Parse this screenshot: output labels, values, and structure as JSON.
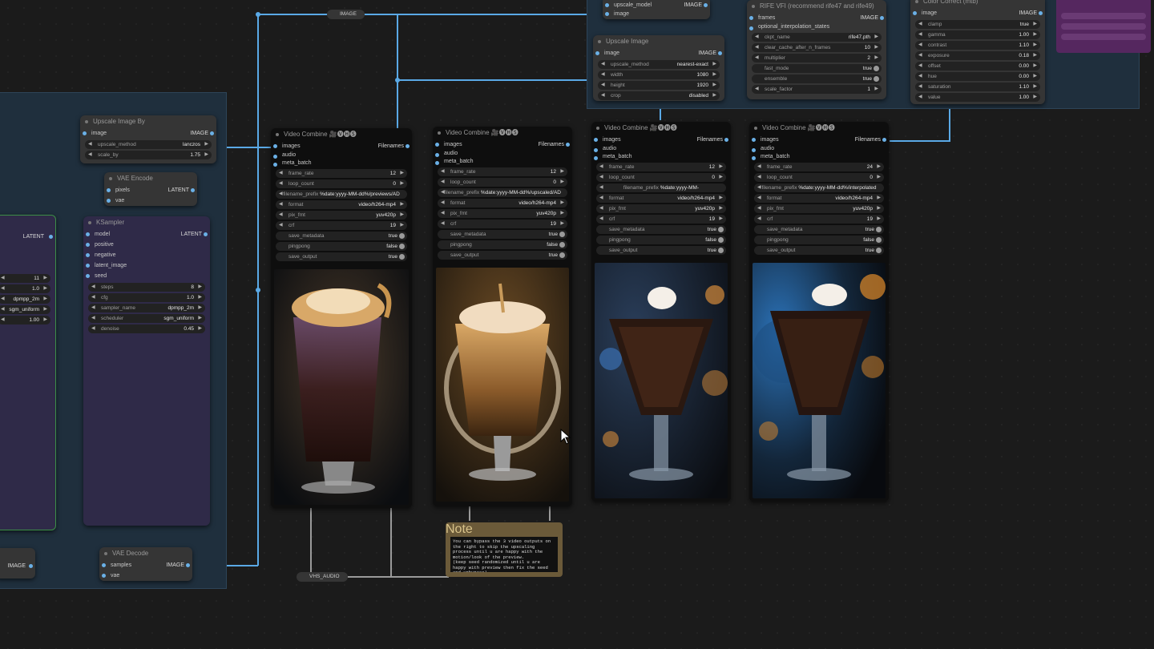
{
  "canvas": {
    "background": "#1b1b1b",
    "wire_blue": "#5aa9e6",
    "wire_pink": "#e6738a",
    "wire_yellow": "#e6c04a",
    "wire_gray": "#a0a0a0"
  },
  "nodes": {
    "upscale_image_by": {
      "title": "Upscale Image By",
      "input": "image",
      "output": "IMAGE",
      "widgets": [
        {
          "label": "upscale_method",
          "value": "lanczos"
        },
        {
          "label": "scale_by",
          "value": "1.75"
        }
      ]
    },
    "vae_encode": {
      "title": "VAE Encode",
      "inputs": [
        "pixels",
        "vae"
      ],
      "output": "LATENT"
    },
    "ksampler": {
      "title": "KSampler",
      "inputs": [
        "model",
        "positive",
        "negative",
        "latent_image"
      ],
      "seed_label": "seed",
      "output": "LATENT",
      "widgets": [
        {
          "label": "steps",
          "value": "8"
        },
        {
          "label": "cfg",
          "value": "1.0"
        },
        {
          "label": "sampler_name",
          "value": "dpmpp_2m"
        },
        {
          "label": "scheduler",
          "value": "sgm_uniform"
        },
        {
          "label": "denoise",
          "value": "0.45"
        }
      ]
    },
    "left_ksampler": {
      "output": "LATENT",
      "values": [
        "11",
        "1.0",
        "dpmpp_2m",
        "sgm_uniform",
        "1.00"
      ]
    },
    "vae_decode": {
      "title": "VAE Decode",
      "inputs": [
        "samples",
        "vae"
      ],
      "output": "IMAGE"
    },
    "left_image_output": "IMAGE",
    "upscale_model_loader": {
      "inputs": [
        "upscale_model",
        "image"
      ],
      "output": "IMAGE"
    },
    "reroute_image": "IMAGE",
    "upscale_image": {
      "title": "Upscale Image",
      "input": "image",
      "output": "IMAGE",
      "widgets": [
        {
          "label": "upscale_method",
          "value": "nearest-exact"
        },
        {
          "label": "width",
          "value": "1080"
        },
        {
          "label": "height",
          "value": "1920"
        },
        {
          "label": "crop",
          "value": "disabled"
        }
      ]
    },
    "rife_vfi": {
      "title": "RIFE VFI (recommend rife47 and rife49)",
      "inputs": [
        "frames",
        "optional_interpolation_states"
      ],
      "output": "IMAGE",
      "widgets": [
        {
          "label": "ckpt_name",
          "value": "rife47.pth",
          "type": "arrows"
        },
        {
          "label": "clear_cache_after_n_frames",
          "value": "10",
          "type": "arrows"
        },
        {
          "label": "multiplier",
          "value": "2",
          "type": "arrows"
        },
        {
          "label": "fast_mode",
          "value": "true",
          "type": "toggle"
        },
        {
          "label": "ensemble",
          "value": "true",
          "type": "toggle"
        },
        {
          "label": "scale_factor",
          "value": "1",
          "type": "arrows"
        }
      ]
    },
    "color_correct": {
      "title": "Color Correct (mtb)",
      "input": "image",
      "output": "IMAGE",
      "widgets": [
        {
          "label": "clamp",
          "value": "true"
        },
        {
          "label": "gamma",
          "value": "1.00"
        },
        {
          "label": "contrast",
          "value": "1.10"
        },
        {
          "label": "exposure",
          "value": "0.18"
        },
        {
          "label": "offset",
          "value": "0.00"
        },
        {
          "label": "hue",
          "value": "0.00"
        },
        {
          "label": "saturation",
          "value": "1.10"
        },
        {
          "label": "value",
          "value": "1.00"
        }
      ]
    },
    "note": {
      "title": "Note",
      "text": "You can bypass the 3 video outputs on the right to skip the upscaling process until u are happy with the motion/look of the preview.\n(keep seed randomized until u are happy with preview then fix the seed and unbypass)"
    },
    "vhs_audio": "VHS_AUDIO"
  },
  "video_combines": [
    {
      "title": "Video Combine 🎥🅥🅗🅢",
      "inputs": [
        "images",
        "audio",
        "meta_batch"
      ],
      "output": "Filenames",
      "widgets": [
        {
          "label": "frame_rate",
          "value": "12"
        },
        {
          "label": "loop_count",
          "value": "0"
        },
        {
          "label": "filename_prefix",
          "value": "%date:yyyy-MM-dd%/previews/AD"
        },
        {
          "label": "format",
          "value": "video/h264-mp4"
        },
        {
          "label": "pix_fmt",
          "value": "yuv420p"
        },
        {
          "label": "crf",
          "value": "19"
        },
        {
          "label": "save_metadata",
          "value": "true",
          "type": "toggle"
        },
        {
          "label": "pingpong",
          "value": "false",
          "type": "toggle"
        },
        {
          "label": "save_output",
          "value": "true",
          "type": "toggle"
        }
      ],
      "preview": "milkshake-preview"
    },
    {
      "title": "Video Combine 🎥🅥🅗🅢",
      "inputs": [
        "images",
        "audio",
        "meta_batch"
      ],
      "output": "Filenames",
      "widgets": [
        {
          "label": "frame_rate",
          "value": "12"
        },
        {
          "label": "loop_count",
          "value": "0"
        },
        {
          "label": "filename_prefix",
          "value": "%date:yyyy-MM-dd%/upscaled/AD"
        },
        {
          "label": "format",
          "value": "video/h264-mp4"
        },
        {
          "label": "pix_fmt",
          "value": "yuv420p"
        },
        {
          "label": "crf",
          "value": "19"
        },
        {
          "label": "save_metadata",
          "value": "true",
          "type": "toggle"
        },
        {
          "label": "pingpong",
          "value": "false",
          "type": "toggle"
        },
        {
          "label": "save_output",
          "value": "true",
          "type": "toggle"
        }
      ],
      "preview": "caramel-sundae"
    },
    {
      "title": "Video Combine 🎥🅥🅗🅢",
      "inputs": [
        "images",
        "audio",
        "meta_batch"
      ],
      "output": "Filenames",
      "widgets": [
        {
          "label": "frame_rate",
          "value": "12"
        },
        {
          "label": "loop_count",
          "value": "0"
        },
        {
          "label": "filename_prefix",
          "value": "%date:yyyy-MM-dd%/upscaled_mod"
        },
        {
          "label": "format",
          "value": "video/h264-mp4"
        },
        {
          "label": "pix_fmt",
          "value": "yuv420p"
        },
        {
          "label": "crf",
          "value": "19"
        },
        {
          "label": "save_metadata",
          "value": "true",
          "type": "toggle"
        },
        {
          "label": "pingpong",
          "value": "false",
          "type": "toggle"
        },
        {
          "label": "save_output",
          "value": "true",
          "type": "toggle"
        }
      ],
      "preview": "chocolate-sundae"
    },
    {
      "title": "Video Combine 🎥🅥🅗🅢",
      "inputs": [
        "images",
        "audio",
        "meta_batch"
      ],
      "output": "Filenames",
      "widgets": [
        {
          "label": "frame_rate",
          "value": "24"
        },
        {
          "label": "loop_count",
          "value": "0"
        },
        {
          "label": "filename_prefix",
          "value": "%date:yyyy-MM-dd%/interpolated"
        },
        {
          "label": "format",
          "value": "video/h264-mp4"
        },
        {
          "label": "pix_fmt",
          "value": "yuv420p"
        },
        {
          "label": "crf",
          "value": "19"
        },
        {
          "label": "save_metadata",
          "value": "true",
          "type": "toggle"
        },
        {
          "label": "pingpong",
          "value": "false",
          "type": "toggle"
        },
        {
          "label": "save_output",
          "value": "true",
          "type": "toggle"
        }
      ],
      "preview": "chocolate-sundae-blue"
    }
  ]
}
